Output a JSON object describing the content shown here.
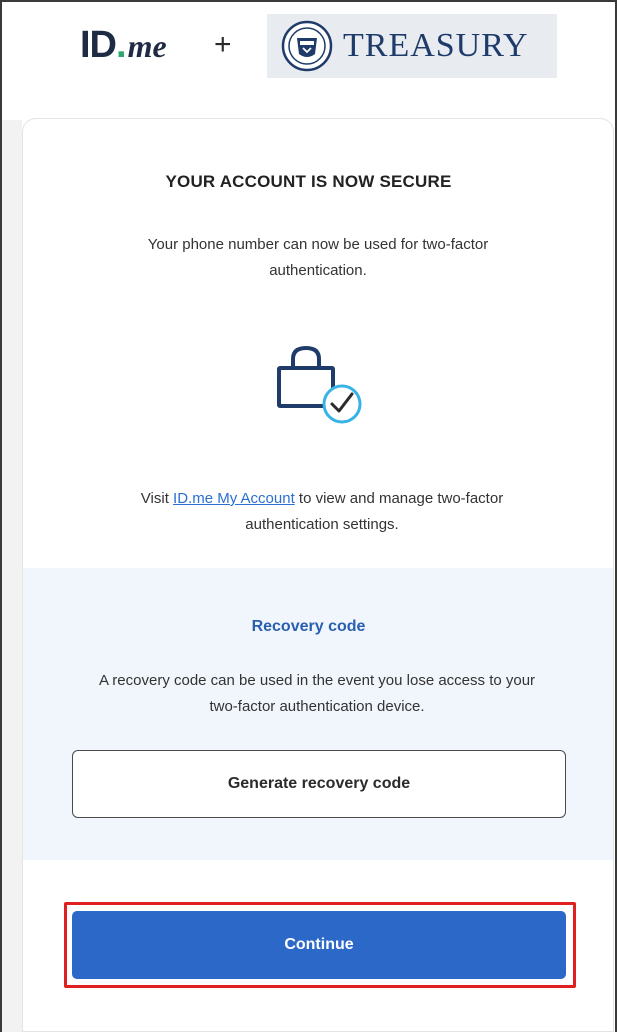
{
  "header": {
    "idme_logo": {
      "id": "ID",
      "dot": ".",
      "me": "me"
    },
    "plus": "+",
    "treasury_text": "TREASURY"
  },
  "card": {
    "title": "YOUR ACCOUNT IS NOW SECURE",
    "description": "Your phone number can now be used for two-factor authentication.",
    "manage": {
      "prefix": "Visit ",
      "link_text": "ID.me My Account",
      "suffix": " to view and manage two-factor authentication settings."
    }
  },
  "recovery": {
    "title": "Recovery code",
    "description": "A recovery code can be used in the event you lose access to your two-factor authentication device.",
    "button_label": "Generate recovery code"
  },
  "actions": {
    "continue_label": "Continue"
  },
  "colors": {
    "primary": "#2c68c8",
    "link": "#2a6fd1",
    "highlight": "#e02020",
    "panel": "#f1f6fc",
    "check_ring": "#37b3e6"
  }
}
